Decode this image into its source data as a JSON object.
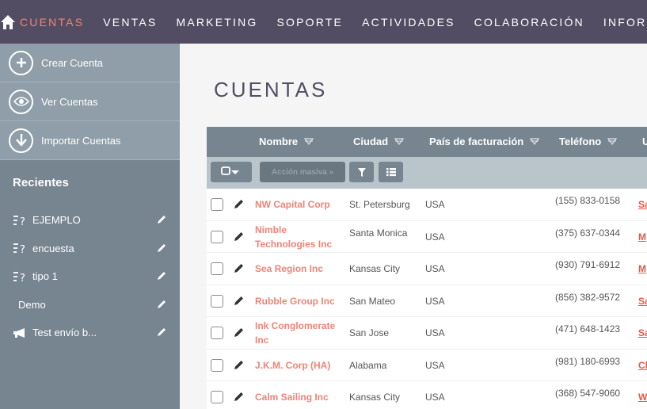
{
  "nav": {
    "items": [
      {
        "label": "CUENTAS",
        "active": true
      },
      {
        "label": "VENTAS",
        "active": false
      },
      {
        "label": "MARKETING",
        "active": false
      },
      {
        "label": "SOPORTE",
        "active": false
      },
      {
        "label": "ACTIVIDADES",
        "active": false
      },
      {
        "label": "COLABORACIÓN",
        "active": false
      },
      {
        "label": "INFORMES",
        "active": false
      }
    ]
  },
  "sidebar": {
    "actions": [
      {
        "label": "Crear Cuenta",
        "icon": "plus-icon"
      },
      {
        "label": "Ver Cuentas",
        "icon": "eye-icon"
      },
      {
        "label": "Importar Cuentas",
        "icon": "download-icon"
      }
    ],
    "recent_title": "Recientes",
    "recent": [
      {
        "label": "EJEMPLO",
        "icon": "list-question-icon"
      },
      {
        "label": "encuesta",
        "icon": "list-question-icon"
      },
      {
        "label": "tipo 1",
        "icon": "list-question-icon"
      },
      {
        "label": "Demo",
        "icon": ""
      },
      {
        "label": "Test envío b...",
        "icon": "megaphone-icon"
      }
    ]
  },
  "main": {
    "title": "CUENTAS",
    "bulk_action_label": "Acción masiva »",
    "columns": [
      "Nombre",
      "Ciudad",
      "País de facturación",
      "Teléfono",
      "U"
    ],
    "rows": [
      {
        "name": "NW Capital Corp",
        "city": "St. Petersburg",
        "country": "USA",
        "phone": "(155) 833-0158",
        "user": "Sa"
      },
      {
        "name": "Nimble Technologies Inc",
        "city": "Santa Monica",
        "country": "USA",
        "phone": "(375) 637-0344",
        "user": "M"
      },
      {
        "name": "Sea Region Inc",
        "city": "Kansas City",
        "country": "USA",
        "phone": "(930) 791-6912",
        "user": "M"
      },
      {
        "name": "Rubble Group Inc",
        "city": "San Mateo",
        "country": "USA",
        "phone": "(856) 382-9572",
        "user": "Sa"
      },
      {
        "name": "Ink Conglomerate Inc",
        "city": "San Jose",
        "country": "USA",
        "phone": "(471) 648-1423",
        "user": "Sa"
      },
      {
        "name": "J.K.M. Corp (HA)",
        "city": "Alabama",
        "country": "USA",
        "phone": "(981) 180-6993",
        "user": "Ch"
      },
      {
        "name": "Calm Sailing Inc",
        "city": "Kansas City",
        "country": "USA",
        "phone": "(368) 547-9060",
        "user": "W"
      }
    ]
  },
  "colors": {
    "nav_bg": "#534d64",
    "accent": "#f08377",
    "sidebar_bg": "#778591",
    "header_bg": "#778591"
  }
}
